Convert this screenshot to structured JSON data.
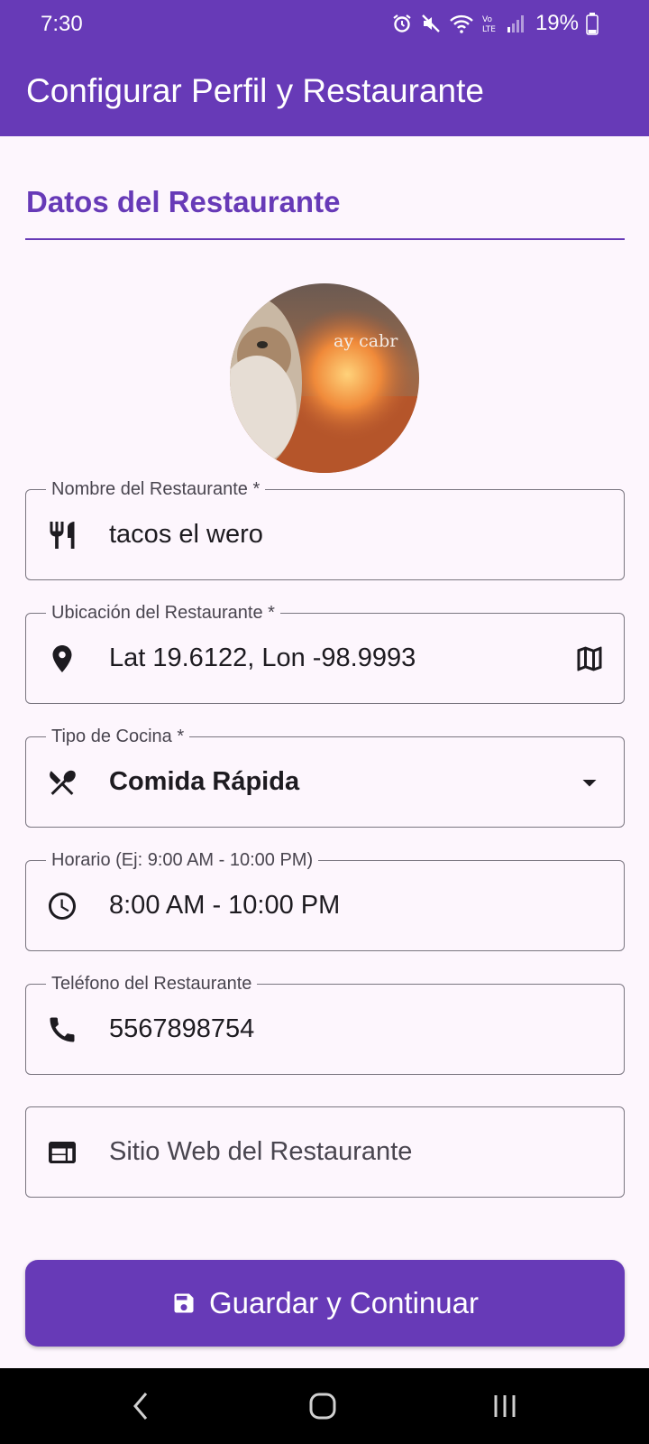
{
  "status_bar": {
    "time": "7:30",
    "battery": "19%",
    "icons": [
      "alarm-icon",
      "mute-icon",
      "wifi-icon",
      "volte-icon",
      "signal-icon",
      "battery-icon"
    ]
  },
  "app_bar": {
    "title": "Configurar Perfil y Restaurante"
  },
  "section": {
    "title": "Datos del Restaurante"
  },
  "avatar": {
    "caption": "ay cabr"
  },
  "fields": {
    "name": {
      "label": "Nombre del Restaurante *",
      "value": "tacos el wero",
      "icon": "restaurant-icon"
    },
    "location": {
      "label": "Ubicación del Restaurante *",
      "value": "Lat 19.6122, Lon -98.9993",
      "icon": "location-pin-icon",
      "trailing_icon": "map-icon"
    },
    "cuisine": {
      "label": "Tipo de Cocina *",
      "value": "Comida Rápida",
      "icon": "utensils-icon",
      "trailing_icon": "dropdown-arrow-icon"
    },
    "hours": {
      "label": "Horario (Ej: 9:00 AM - 10:00 PM)",
      "value": "8:00 AM - 10:00 PM",
      "icon": "clock-icon"
    },
    "phone": {
      "label": "Teléfono del Restaurante",
      "value": "5567898754",
      "icon": "phone-icon"
    },
    "website": {
      "placeholder": "Sitio Web del Restaurante",
      "value": "",
      "icon": "web-icon"
    }
  },
  "save_button": {
    "label": "Guardar y Continuar",
    "icon": "save-icon"
  },
  "colors": {
    "primary": "#673ab7",
    "background": "#fdf6fd",
    "outline": "#7a7680",
    "label": "#49454f"
  }
}
